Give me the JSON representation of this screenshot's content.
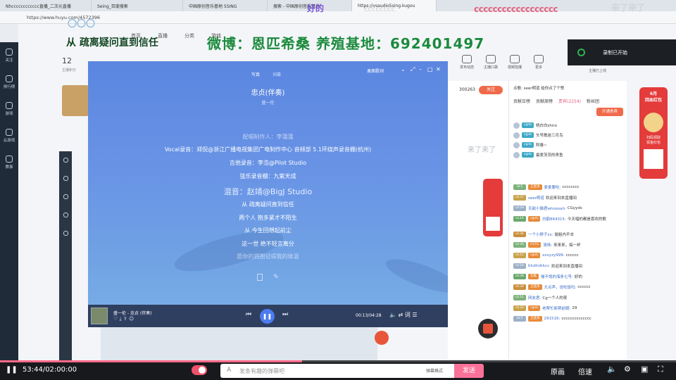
{
  "browser": {
    "tabs": [
      "Nhcccccccccccc直播_二次元直播",
      "Seing_百度搜索",
      "中国原创音乐基地 5SING",
      "搜索 - 中国原创音乐基地",
      "https://vsaudio5sing.kugou"
    ],
    "address": "https://www.huyu.com/4572396"
  },
  "overlays": {
    "banner_left": "从 疏离疑问直到信任",
    "banner_main": "微博：恩匹希桑 养殖基地：692401497",
    "banner_top_right": "cccccccccccccccccc",
    "banner_top_mid": "好的",
    "banner_top_far": "来了来了",
    "banner_top_c": "cccccccc",
    "banner_left_top": "〇〇〇",
    "banner_mid_right": "来了来了"
  },
  "nav": {
    "items": [
      "首页",
      "直播",
      "分类",
      "游戏"
    ],
    "icons": [
      "发布动态",
      "主播口袋",
      "视频陆播",
      "更多"
    ],
    "live": "主播已上线"
  },
  "room": {
    "number": "12",
    "number_label": "主播积分",
    "followers": "300263",
    "follow_label": "关注"
  },
  "player": {
    "tab_lyric": "写真",
    "tab_scroll": "词幕",
    "desk_lyric": "桌面歌词",
    "title": "忠贞(伴奏)",
    "artist": "盛一伦",
    "lyrics": [
      {
        "text": "配唱制作人：李蒲蒲",
        "style": "dim"
      },
      {
        "text": "Vocal录音：郑倪@浙江广播电视集团广电制作中心 音频部 5.1环绕声录音棚(杭州)",
        "style": "normal"
      },
      {
        "text": "吉他录音：李浩@Pilot Studio",
        "style": "normal"
      },
      {
        "text": "弦乐录音棚：九紫天成",
        "style": "normal"
      },
      {
        "text": "混音：赵靖@BigJ Studio",
        "style": "hi"
      },
      {
        "text": "从 疏离疑问直到信任",
        "style": "normal"
      },
      {
        "text": "两个人 抱多紧才不陌生",
        "style": "normal"
      },
      {
        "text": "从 今生回想起前尘",
        "style": "normal"
      },
      {
        "text": "这一世 绝不轻言离分",
        "style": "normal"
      },
      {
        "text": "愿你的拥抱记得我的体温",
        "style": "dim"
      }
    ],
    "now_playing": "盛一伦 - 忠贞 (伴奏)",
    "time": "00:13/04:28",
    "play_icon": "pause-icon"
  },
  "chat": {
    "tabs": [
      "贡献日榜",
      "贡献周榜",
      "贵宾(2254)",
      "粉丝团"
    ],
    "notice": "点歌: seer明道 给你点了个赞",
    "ranks": [
      {
        "badge": "cgnb",
        "user": "桃白白shiro"
      },
      {
        "badge": "cgnb",
        "user": "头号歌迷三月鸟"
      },
      {
        "badge": "cgnb",
        "user": "阿泰~"
      },
      {
        "badge": "cgnb",
        "user": "最爱茨茨的青鱼"
      }
    ],
    "messages": [
      {
        "lv": "LV.5",
        "badge": "王昱泽",
        "user": "麦麦要吃:",
        "text": "cccccccc"
      },
      {
        "lv": "LV.37",
        "badge": "",
        "user": "seer明道",
        "text": "欢迎来到本直播间"
      },
      {
        "lv": "LV.29",
        "badge": "",
        "user": "无敌小猫君whoosah:",
        "text": "CGyyds"
      },
      {
        "lv": "LV.16",
        "badge": "cgnb",
        "user": "白鹤864315:",
        "text": "今天唱的都是喜欢的歌"
      },
      {
        "lv": "LV.36",
        "badge": "",
        "user": "一个小胖子xs:",
        "text": "姐姐内不去"
      },
      {
        "lv": "LV.34",
        "badge": "CSTG",
        "user": "清扬:",
        "text": "来来来，搞一杯"
      },
      {
        "lv": "LV.15",
        "badge": "cgnb",
        "user": "xxxyzy999:",
        "text": "cccccc"
      },
      {
        "lv": "LV.18",
        "badge": "",
        "user": "blublubluu:",
        "text": "欢迎来到本直播间"
      },
      {
        "lv": "LV.38",
        "badge": "云尾",
        "user": "喵不饱的海条七号:",
        "text": "好的"
      },
      {
        "lv": "LV.30",
        "badge": "王昱泽",
        "user": "大点声，说吃饭吗:",
        "text": "cccccc"
      },
      {
        "lv": "LV.11",
        "badge": "",
        "user": "网友君:",
        "text": "Cg一个人的夜"
      },
      {
        "lv": "LV.32",
        "badge": "cgnb",
        "user": "老帮忙新帮前朝:",
        "text": "29"
      },
      {
        "lv": "LV.5",
        "badge": "王昱泽",
        "user": "291516:",
        "text": "cccccccccccccc"
      }
    ],
    "join_btn": "开通贵宾"
  },
  "record": {
    "text": "录制已开始"
  },
  "bottom": {
    "time": "53:44/02:00:00",
    "danmu_placeholder": "发条有趣的弹幕吧",
    "danmu_label": "弹幕格式",
    "send": "发送",
    "quality": "原画",
    "speed": "倍速",
    "progress": 0.447
  },
  "ads": {
    "right_title": "6月\n回血红包",
    "right_sub": "扫码领取\n现金红包"
  },
  "colors": {
    "accent": "#fb7299",
    "player_bg": "#5b86e0",
    "play_btn": "#4b7cf0"
  }
}
